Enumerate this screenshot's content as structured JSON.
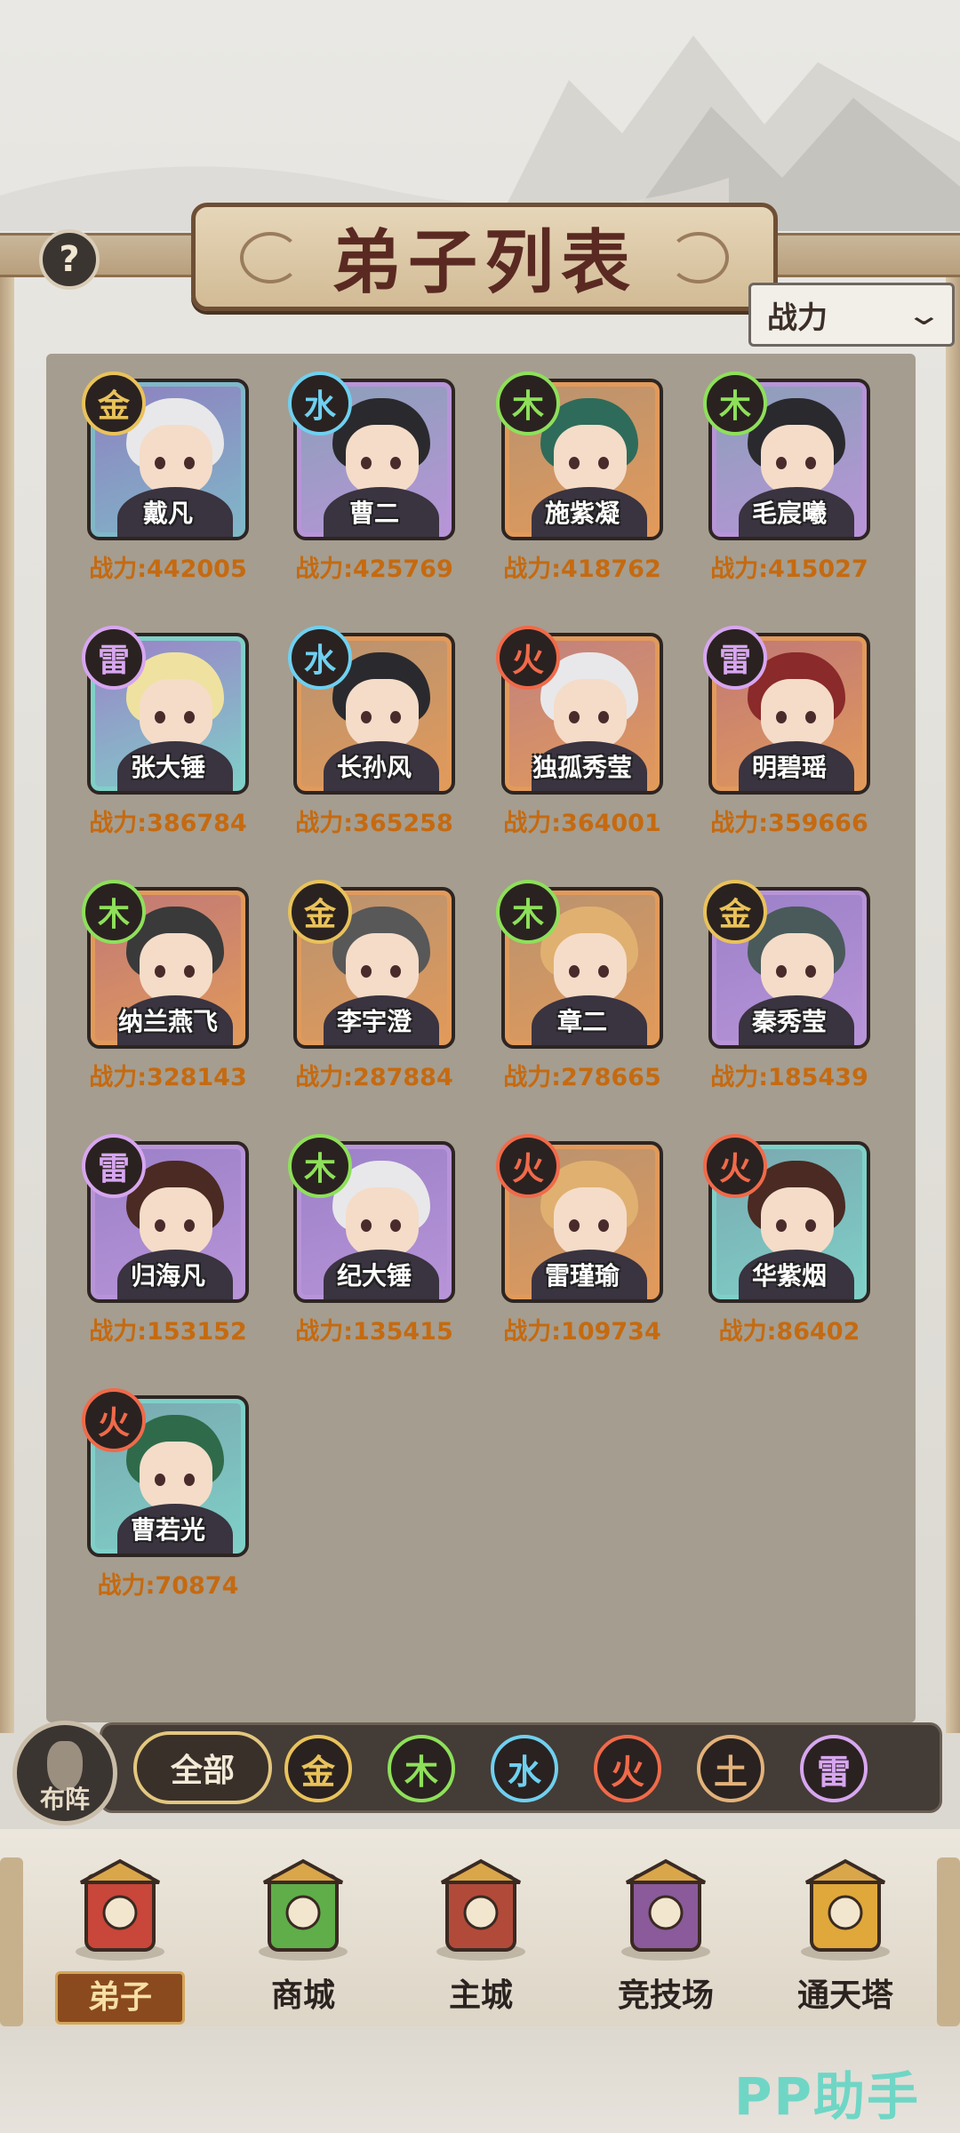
{
  "header": {
    "title": "弟子列表",
    "help_icon": "?",
    "sort_label": "战力",
    "sort_chevron": "chevron-down-icon"
  },
  "colors": {
    "power_text": "#c56a10",
    "panel_bg": "#a59d8f",
    "element_gold": "#e9c25a",
    "element_water": "#6fd0f0",
    "element_wood": "#8ee05a",
    "element_fire": "#f06a4a",
    "element_thunder": "#d7a6f0",
    "element_earth": "#e3b27a"
  },
  "disciples": [
    {
      "name": "戴凡",
      "element": "金",
      "power": "战力:442005",
      "frame": "#7fb8c8",
      "bg": "#8f7fc0",
      "hair": "#e8e8ea"
    },
    {
      "name": "曹二",
      "element": "水",
      "power": "战力:425769",
      "frame": "#b894d8",
      "bg": "#8aa0b8",
      "hair": "#2a2a2e"
    },
    {
      "name": "施紫凝",
      "element": "木",
      "power": "战力:418762",
      "frame": "#e29a5a",
      "bg": "#b89270",
      "hair": "#2f6b5a"
    },
    {
      "name": "毛宸曦",
      "element": "木",
      "power": "战力:415027",
      "frame": "#b894d8",
      "bg": "#8aa0b8",
      "hair": "#2a2a2e"
    },
    {
      "name": "张大锤",
      "element": "雷",
      "power": "战力:386784",
      "frame": "#7fd0c8",
      "bg": "#9b80c8",
      "hair": "#efe2a0"
    },
    {
      "name": "长孙风",
      "element": "水",
      "power": "战力:365258",
      "frame": "#e29a5a",
      "bg": "#b89270",
      "hair": "#2a2a2e"
    },
    {
      "name": "独孤秀莹",
      "element": "火",
      "power": "战力:364001",
      "frame": "#e29a5a",
      "bg": "#c08080",
      "hair": "#e8e8ea"
    },
    {
      "name": "明碧瑶",
      "element": "雷",
      "power": "战力:359666",
      "frame": "#e29a5a",
      "bg": "#c07878",
      "hair": "#8a2a2a"
    },
    {
      "name": "纳兰燕飞",
      "element": "木",
      "power": "战力:328143",
      "frame": "#e29a5a",
      "bg": "#c07878",
      "hair": "#3a3a3a"
    },
    {
      "name": "李宇澄",
      "element": "金",
      "power": "战力:287884",
      "frame": "#e29a5a",
      "bg": "#b89270",
      "hair": "#585858"
    },
    {
      "name": "章二",
      "element": "木",
      "power": "战力:278665",
      "frame": "#e29a5a",
      "bg": "#b89270",
      "hair": "#e0b070"
    },
    {
      "name": "秦秀莹",
      "element": "金",
      "power": "战力:185439",
      "frame": "#b894d8",
      "bg": "#9b80c8",
      "hair": "#4a5a5a"
    },
    {
      "name": "归海凡",
      "element": "雷",
      "power": "战力:153152",
      "frame": "#b894d8",
      "bg": "#9b80c8",
      "hair": "#4a2a22"
    },
    {
      "name": "纪大锤",
      "element": "木",
      "power": "战力:135415",
      "frame": "#b894d8",
      "bg": "#9b80c8",
      "hair": "#e8e8ea"
    },
    {
      "name": "雷瑾瑜",
      "element": "火",
      "power": "战力:109734",
      "frame": "#e29a5a",
      "bg": "#b89270",
      "hair": "#e0b070"
    },
    {
      "name": "华紫烟",
      "element": "火",
      "power": "战力:86402",
      "frame": "#7fd0c8",
      "bg": "#7aa8b0",
      "hair": "#4a2a22"
    },
    {
      "name": "曹若光",
      "element": "火",
      "power": "战力:70874",
      "frame": "#7fd0c8",
      "bg": "#7aa8b0",
      "hair": "#2f6b4a"
    }
  ],
  "filter": {
    "formation_label": "布阵",
    "all_label": "全部",
    "elements": [
      "金",
      "木",
      "水",
      "火",
      "土",
      "雷"
    ]
  },
  "nav": [
    {
      "label": "弟子",
      "icon": "disciple-banner-icon",
      "active": true
    },
    {
      "label": "商城",
      "icon": "shop-jade-icon",
      "active": false
    },
    {
      "label": "主城",
      "icon": "city-gate-icon",
      "active": false
    },
    {
      "label": "竞技场",
      "icon": "crossed-swords-icon",
      "active": false
    },
    {
      "label": "通天塔",
      "icon": "tower-icon",
      "active": false
    }
  ],
  "watermark": "PP助手"
}
